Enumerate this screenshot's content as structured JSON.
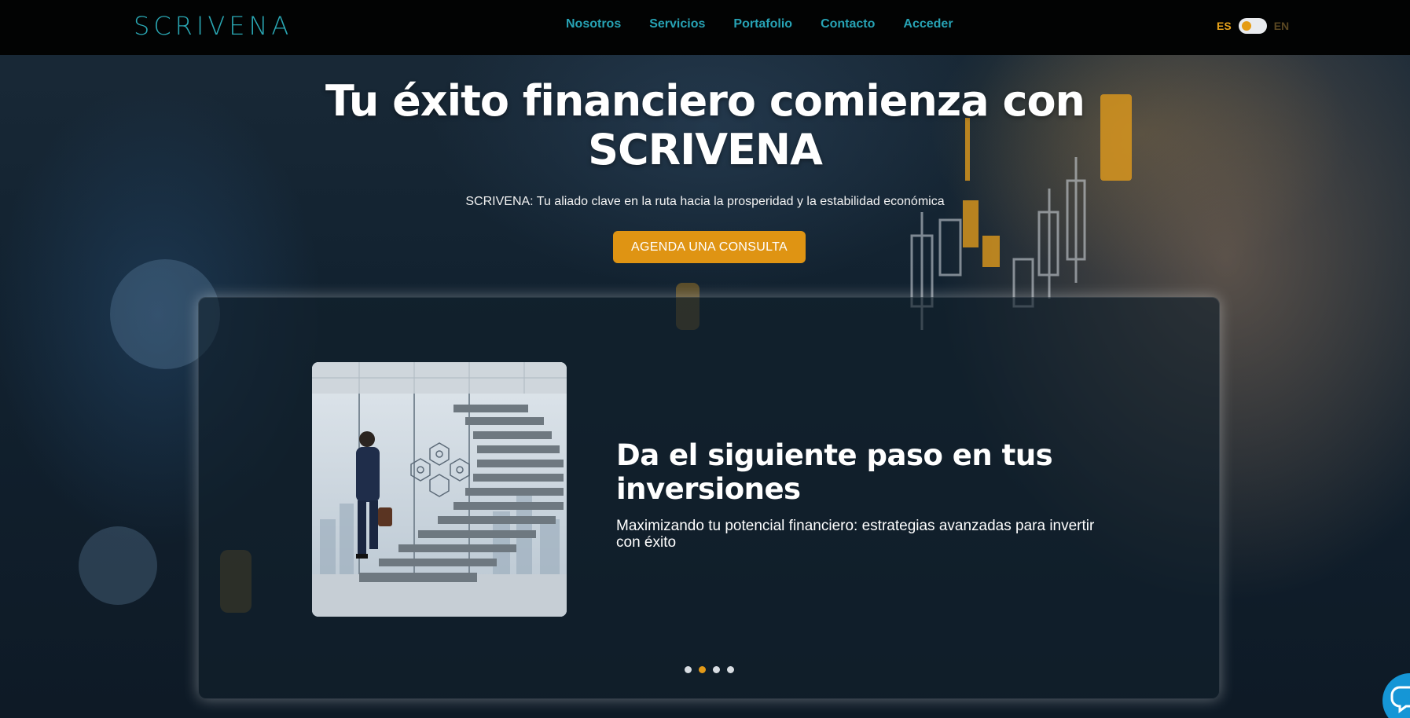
{
  "header": {
    "logo": "SCRIVENA",
    "nav": [
      "Nosotros",
      "Servicios",
      "Portafolio",
      "Contacto",
      "Acceder"
    ],
    "lang": {
      "es": "ES",
      "en": "EN"
    }
  },
  "hero": {
    "title": "Tu éxito financiero comienza con SCRIVENA",
    "subtitle": "SCRIVENA: Tu aliado clave en la ruta hacia la prosperidad y la estabilidad económica",
    "cta": "AGENDA UNA CONSULTA"
  },
  "carousel": {
    "title": "Da el siguiente paso en tus inversiones",
    "text": "Maximizando tu potencial financiero: estrategias avanzadas para invertir con éxito",
    "dot_count": 4,
    "active_dot": 2
  },
  "colors": {
    "accent": "#df9413",
    "nav": "#27a3b5",
    "header_bg": "#020303",
    "chat": "#1596d6"
  },
  "icons": [
    "chat-icon"
  ]
}
